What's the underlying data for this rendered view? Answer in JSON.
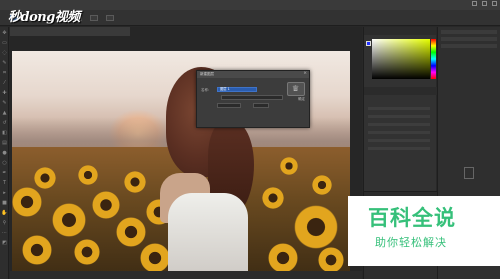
{
  "watermark": {
    "logo_text": "秒dong视频",
    "baike_title": "百科全说",
    "baike_subtitle": "助你轻松解决"
  },
  "colors": {
    "accent": "#2a5db0",
    "baike_green": "#36c07a",
    "ui_bg": "#282828"
  },
  "dialog": {
    "title": "新建图层",
    "name_label": "名称:",
    "name_value": "图层 1",
    "confirm_icon": "trophy-icon",
    "confirm_label": "确定"
  }
}
